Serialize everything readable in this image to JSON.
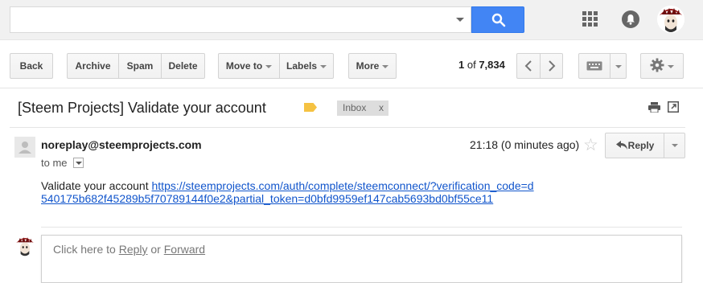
{
  "search": {
    "value": "",
    "placeholder": ""
  },
  "toolbar": {
    "back": "Back",
    "archive": "Archive",
    "spam": "Spam",
    "delete": "Delete",
    "move_to": "Move to",
    "labels": "Labels",
    "more": "More"
  },
  "pager": {
    "current": "1",
    "of": "of",
    "total": "7,834"
  },
  "email": {
    "subject": "[Steem Projects] Validate your account",
    "label_chip": "Inbox",
    "label_chip_close": "x",
    "sender": "noreplay@steemprojects.com",
    "time": "21:18 (0 minutes ago)",
    "to": "to me",
    "reply_label": "Reply",
    "body_prefix": "Validate your account",
    "body_link": "https://steemprojects.com/auth/complete/steemconnect/?verification_code=d540175b682f45289b5f70789144f0e2&partial_token=d0bfd9959ef147cab5693bd0bf55ce11"
  },
  "reply_box": {
    "prefix": "Click here to",
    "reply": "Reply",
    "or": "or",
    "forward": "Forward"
  },
  "colors": {
    "accent": "#4285f4",
    "link": "#1155cc",
    "label_tag": "#f5c242"
  }
}
